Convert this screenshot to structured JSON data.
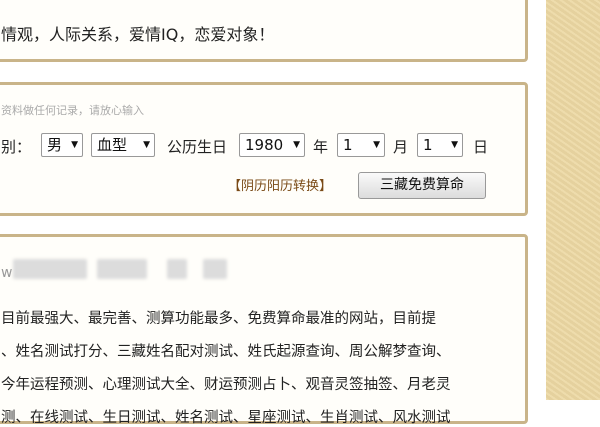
{
  "top_panel": {
    "text": "情观，人际关系，爱情IQ，恋爱对象！"
  },
  "form_panel": {
    "notice": "资料做任何记录，请放心输入",
    "gender_label": "别：",
    "gender_value": "男",
    "blood_value": "血型",
    "birthday_label": "公历生日",
    "year_value": "1980",
    "year_unit": "年",
    "month_value": "1",
    "month_unit": "月",
    "day_value": "1",
    "day_unit": "日",
    "convert_link": "【阴历阳历转换】",
    "calc_button": "三藏免费算命"
  },
  "content_panel": {
    "url_prefix": "w",
    "lines": [
      "目前最强大、最完善、测算功能最多、免费算命最准的网站，目前提",
      "、姓名测试打分、三藏姓名配对测试、姓氏起源查询、周公解梦查询、",
      "今年运程预测、心理测试大全、财运预测占卜、观音灵签抽签、月老灵",
      "测、在线测试、生日测试、姓名测试、星座测试、生肖测试、风水测试"
    ]
  },
  "icons": {
    "dropdown": "chevron-down-icon"
  }
}
